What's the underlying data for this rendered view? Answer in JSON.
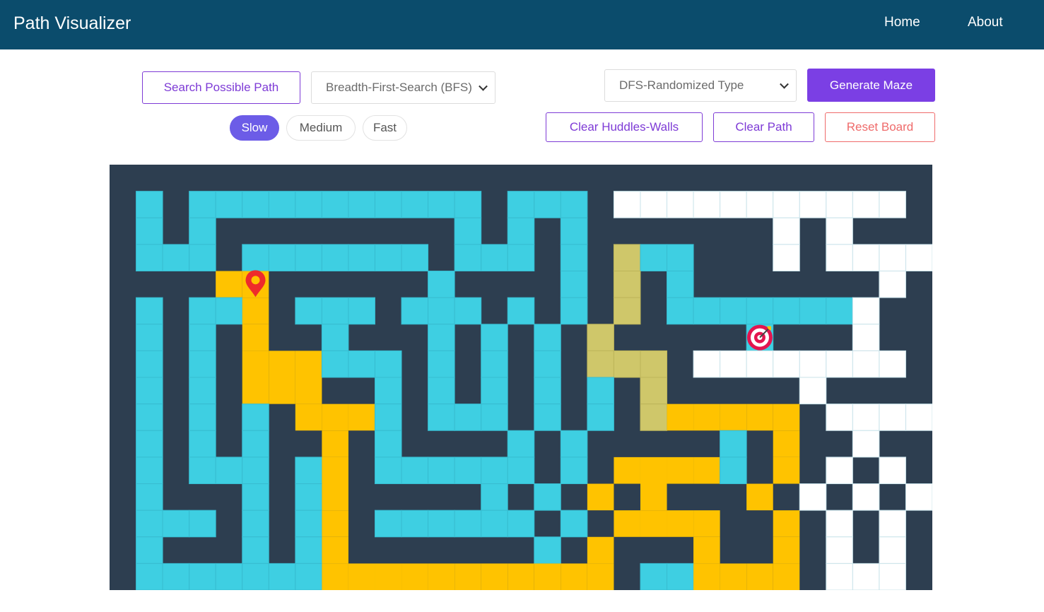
{
  "navbar": {
    "brand": "Path Visualizer",
    "links": [
      "Home",
      "About"
    ]
  },
  "controls": {
    "search_button": "Search Possible Path",
    "algorithm_select": "Breadth-First-Search (BFS)",
    "speed": {
      "options": [
        "Slow",
        "Medium",
        "Fast"
      ],
      "selected": "Slow"
    },
    "maze_type_select": "DFS-Randomized Type",
    "generate_button": "Generate Maze",
    "clear_walls_button": "Clear Huddles-Walls",
    "clear_path_button": "Clear Path",
    "reset_button": "Reset Board"
  },
  "board": {
    "rows": 16,
    "cols": 31,
    "legend": {
      "#": "wall",
      "C": "visited",
      "W": "unvisited",
      "Y": "path",
      "A": "animating",
      "S": "start",
      "T": "target"
    },
    "grid": [
      "###############################",
      "#C#CCCCCCCCCCC#CCC#WWWWWWWWWWW#",
      "#C#C#########C#C#C#######W#W###",
      "#CCC#CCCCCCC#CCC#C#ACC###W#WWWW",
      "####YS######C####C#A#C#######W#",
      "#C#CCY#CCC#CCC#C#C#A#CCCCCCCW##",
      "#C#C#Y##C###C#C#C#A#####T###W##",
      "#C#C#YYYCCC#C#C#C#AAA#WWWWWWWW#",
      "#C#C#YYY##C#C#C#C#C#A#####W####",
      "#C#C#C#YYYC#CCC#C#C#AYYYYY#WWWW",
      "#C#C#C##Y#C####C#C#####C#Y##W##",
      "#C#CCC#CY#CCCCCC#C#YYYYC#Y#W#W#",
      "#C###C#CY#####C#C#Y#Y###Y#W#W#W",
      "#CCC#C#CY#CCCCCC#C#YYYY##Y#W#W#",
      "#C###C#CY#######C#Y###Y##Y#W#W#",
      "#CCCCCCCYYYYYYYYYYY#CCYYYY#WWW#"
    ],
    "colors": {
      "wall": "#2d3e50",
      "visited": "#3ecfe2",
      "unvisited": "#ffffff",
      "path": "#ffc300",
      "animating": "#cfc76a"
    }
  }
}
